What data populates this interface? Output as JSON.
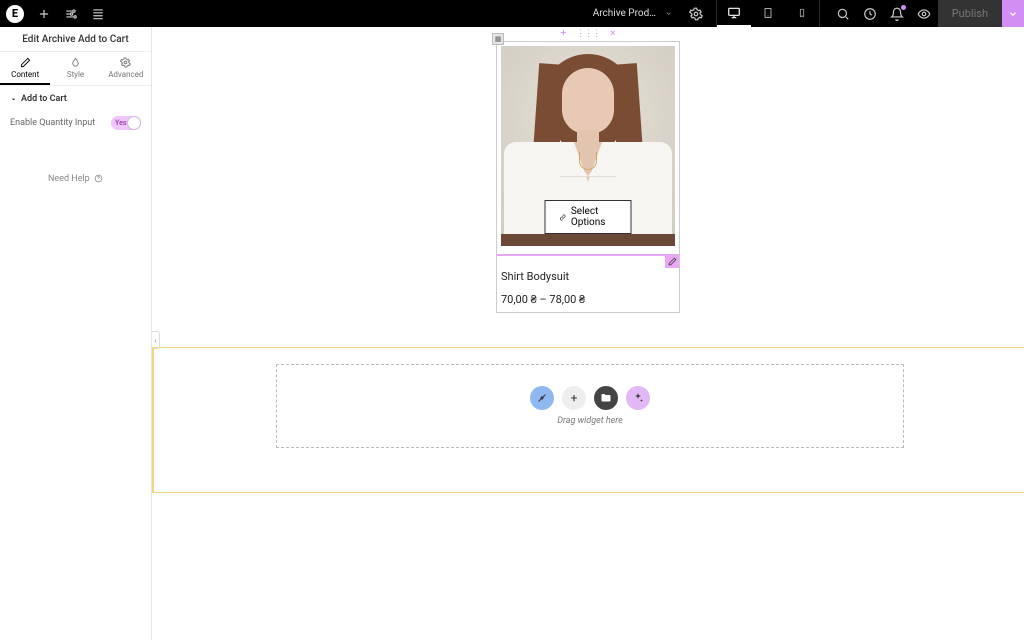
{
  "topbar": {
    "doc_title": "Archive Product ...",
    "publish": "Publish"
  },
  "panel": {
    "title": "Edit Archive Add to Cart",
    "tabs": {
      "content": "Content",
      "style": "Style",
      "advanced": "Advanced"
    },
    "section": "Add to Cart",
    "qty_label": "Enable Quantity Input",
    "toggle_text": "Yes",
    "help": "Need Help"
  },
  "product": {
    "select_btn": "Select Options",
    "name": "Shirt Bodysuit",
    "price": "70,00 ₴ – 78,00 ₴"
  },
  "dropzone": {
    "hint": "Drag widget here"
  },
  "icons": {
    "logo": "E",
    "plus": "+",
    "close": "×",
    "folder": "folder",
    "sparkle": "sparkle"
  }
}
